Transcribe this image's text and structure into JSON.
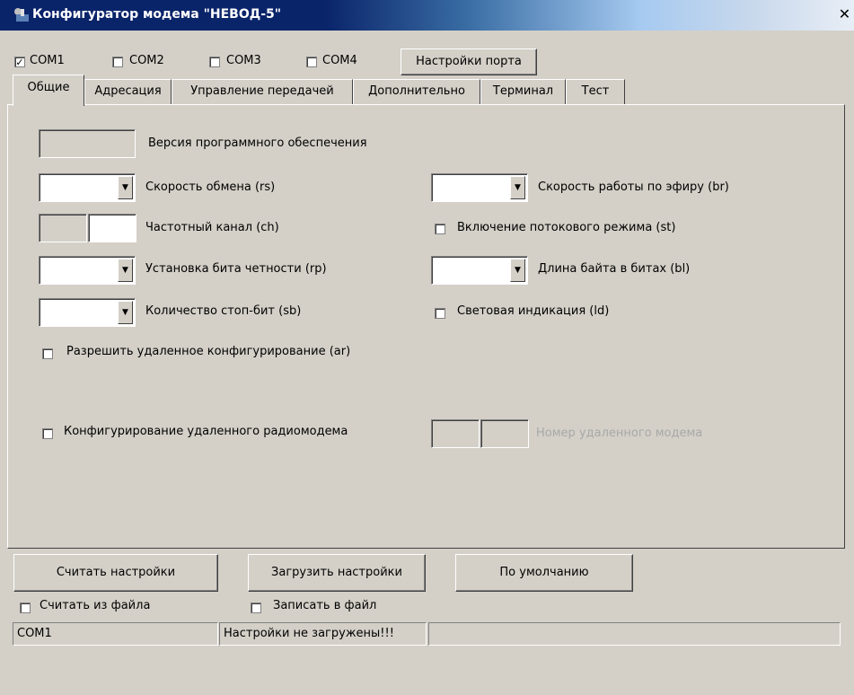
{
  "window": {
    "title": "Конфигуратор модема \"НЕВОД-5\"",
    "close_glyph": "✕"
  },
  "ports": [
    {
      "label": "COM1",
      "checked": true
    },
    {
      "label": "COM2",
      "checked": false
    },
    {
      "label": "COM3",
      "checked": false
    },
    {
      "label": "COM4",
      "checked": false
    }
  ],
  "port_settings_label": "Настройки порта",
  "tabs": [
    {
      "label": "Общие",
      "active": true
    },
    {
      "label": "Адресация",
      "active": false
    },
    {
      "label": "Управление передачей",
      "active": false
    },
    {
      "label": "Дополнительно",
      "active": false
    },
    {
      "label": "Терминал",
      "active": false
    },
    {
      "label": "Тест",
      "active": false
    }
  ],
  "general": {
    "firmware_version_label": "Версия программного обеспечения",
    "exchange_speed_label": "Скорость обмена (rs)",
    "frequency_channel_label": "Частотный канал (ch)",
    "parity_label": "Установка бита четности (rp)",
    "stop_bits_label": "Количество стоп-бит (sb)",
    "air_speed_label": "Скорость работы по эфиру (br)",
    "stream_mode_label": "Включение потокового режима (st)",
    "byte_length_label": "Длина байта в битах (bl)",
    "led_indication_label": "Световая индикация (ld)",
    "allow_remote_config_label": "Разрешить удаленное конфигурирование (ar)",
    "remote_modem_config_label": "Конфигурирование удаленного радиомодема",
    "remote_modem_number_label": "Номер удаленного модема"
  },
  "buttons": {
    "read_settings": "Считать настройки",
    "load_settings": "Загрузить настройки",
    "defaults": "По умолчанию"
  },
  "read_from_file_label": "Считать из файла",
  "write_to_file_label": "Записать в файл",
  "status": {
    "port": "COM1",
    "message": "Настройки не загружены!!!"
  },
  "check_glyph": "✓",
  "dropdown_glyph": "▼"
}
